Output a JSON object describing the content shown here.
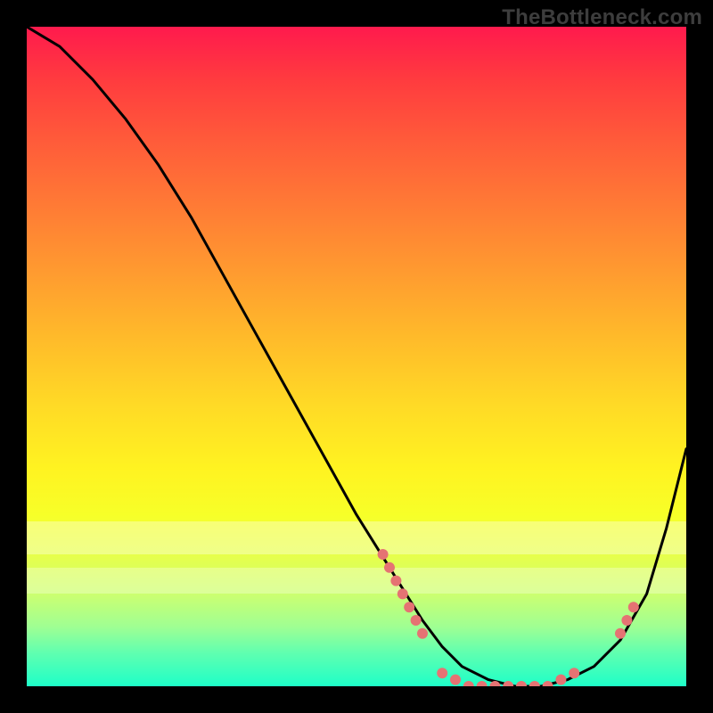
{
  "watermark": "TheBottleneck.com",
  "chart_data": {
    "type": "line",
    "title": "",
    "xlabel": "",
    "ylabel": "",
    "xlim": [
      0,
      100
    ],
    "ylim": [
      0,
      100
    ],
    "grid": false,
    "legend": false,
    "note": "Axis values are estimated as percentages; no tick labels are shown in the image.",
    "series": [
      {
        "name": "bottleneck-curve",
        "x": [
          0,
          5,
          10,
          15,
          20,
          25,
          30,
          35,
          40,
          45,
          50,
          55,
          60,
          63,
          66,
          70,
          74,
          78,
          82,
          86,
          90,
          94,
          97,
          100
        ],
        "y": [
          100,
          97,
          92,
          86,
          79,
          71,
          62,
          53,
          44,
          35,
          26,
          18,
          10,
          6,
          3,
          1,
          0,
          0,
          1,
          3,
          7,
          14,
          24,
          36
        ],
        "color": "#000000"
      }
    ],
    "markers": [
      {
        "x": 54,
        "y": 20
      },
      {
        "x": 55,
        "y": 18
      },
      {
        "x": 56,
        "y": 16
      },
      {
        "x": 57,
        "y": 14
      },
      {
        "x": 58,
        "y": 12
      },
      {
        "x": 59,
        "y": 10
      },
      {
        "x": 60,
        "y": 8
      },
      {
        "x": 63,
        "y": 2
      },
      {
        "x": 65,
        "y": 1
      },
      {
        "x": 67,
        "y": 0
      },
      {
        "x": 69,
        "y": 0
      },
      {
        "x": 71,
        "y": 0
      },
      {
        "x": 73,
        "y": 0
      },
      {
        "x": 75,
        "y": 0
      },
      {
        "x": 77,
        "y": 0
      },
      {
        "x": 79,
        "y": 0
      },
      {
        "x": 81,
        "y": 1
      },
      {
        "x": 83,
        "y": 2
      },
      {
        "x": 90,
        "y": 8
      },
      {
        "x": 91,
        "y": 10
      },
      {
        "x": 92,
        "y": 12
      }
    ],
    "marker_color": "#e57373",
    "pale_bands": [
      {
        "top_pct": 75,
        "height_pct": 5,
        "opacity": 0.35
      },
      {
        "top_pct": 82,
        "height_pct": 4,
        "opacity": 0.3
      }
    ]
  }
}
